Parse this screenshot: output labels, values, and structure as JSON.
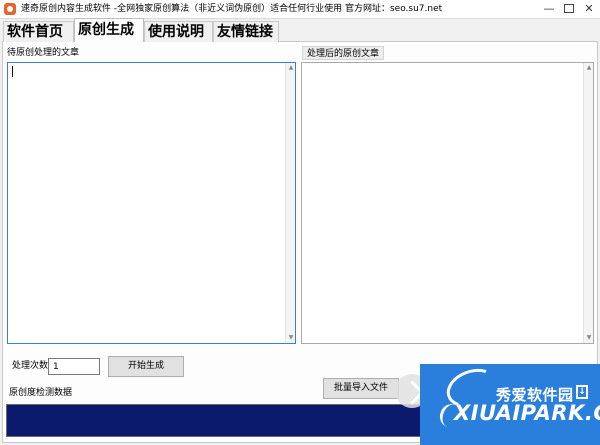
{
  "window": {
    "title": "速奇原创内容生成软件 -全网独家原创算法（非近义词伪原创）适合任何行业使用 官方网址：seo.su7.net",
    "minimize_glyph": "—",
    "close_glyph": "✕"
  },
  "tabs": [
    {
      "label": "软件首页",
      "active": false
    },
    {
      "label": "原创生成",
      "active": true
    },
    {
      "label": "使用说明",
      "active": false
    },
    {
      "label": "友情链接",
      "active": false
    }
  ],
  "source": {
    "label": "待原创处理的文章",
    "value": ""
  },
  "result": {
    "label": "处理后的原创文章",
    "value": ""
  },
  "controls": {
    "count_label": "处理次数",
    "count_value": "1",
    "start_button": "开始生成",
    "import_button": "批量导入文件"
  },
  "detection": {
    "label": "原创度检测数据",
    "bar_color": "#0c1a6e"
  },
  "watermark": {
    "text_cn": "秀爱软件园",
    "text_en": "XIUAIPARK.COM",
    "color": "#2b7fdc"
  },
  "icons": {
    "app": "app-logo-icon",
    "scroll_up": "chevron-up-icon",
    "scroll_down": "chevron-down-icon"
  }
}
